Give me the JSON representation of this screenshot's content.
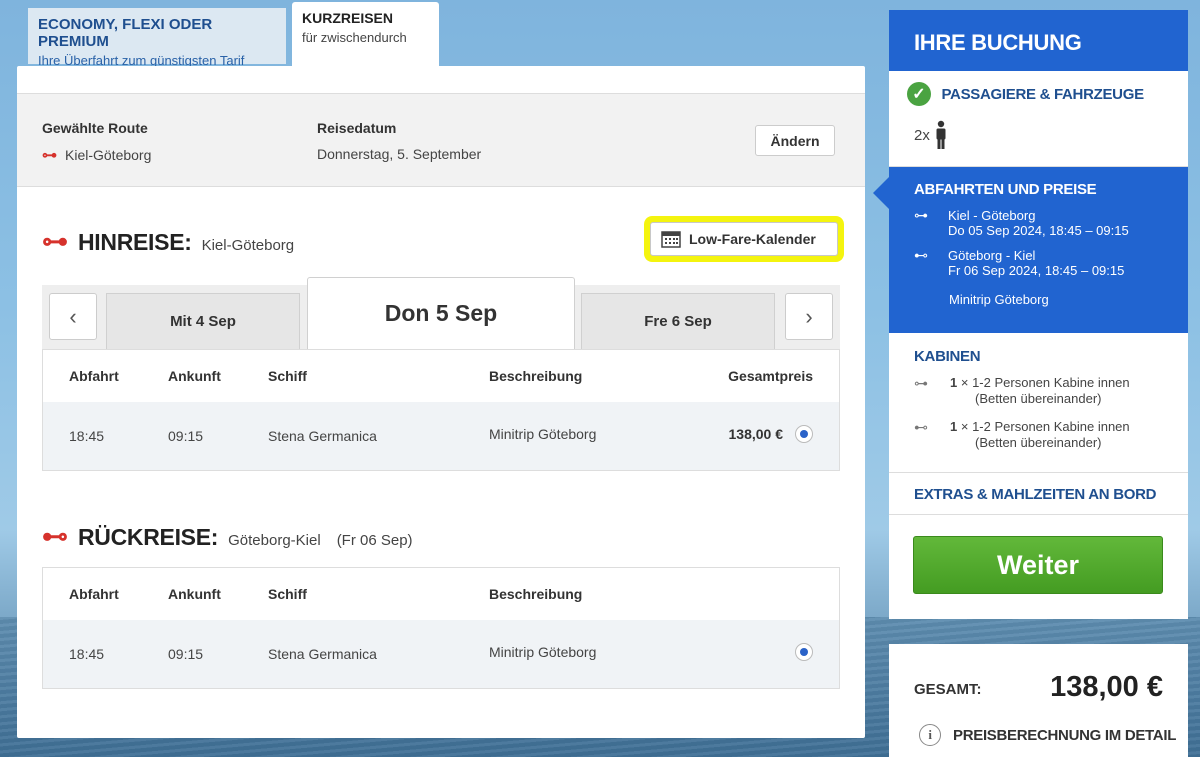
{
  "tabs": {
    "economy": {
      "title": "ECONOMY, FLEXI ODER PREMIUM",
      "subtitle": "Ihre Überfahrt zum günstigsten Tarif"
    },
    "kurzreisen": {
      "title": "KURZREISEN",
      "subtitle": "für zwischendurch"
    }
  },
  "route_box": {
    "route_label": "Gewählte Route",
    "route_value": "Kiel-Göteborg",
    "date_label": "Reisedatum",
    "date_value": "Donnerstag, 5. September",
    "change_button": "Ändern"
  },
  "hinreise": {
    "title": "HINREISE:",
    "route": "Kiel-Göteborg",
    "low_fare_button": "Low-Fare-Kalender",
    "days": {
      "prev": "Mit 4 Sep",
      "active": "Don 5 Sep",
      "next": "Fre 6 Sep"
    },
    "headers": [
      "Abfahrt",
      "Ankunft",
      "Schiff",
      "Beschreibung",
      "Gesamtpreis"
    ],
    "row": {
      "abfahrt": "18:45",
      "ankunft": "09:15",
      "schiff": "Stena Germanica",
      "beschreibung": "Minitrip Göteborg",
      "preis": "138,00 €"
    }
  },
  "rueckreise": {
    "title": "RÜCKREISE:",
    "route": "Göteborg-Kiel",
    "date": "(Fr 06 Sep)",
    "headers": [
      "Abfahrt",
      "Ankunft",
      "Schiff",
      "Beschreibung"
    ],
    "row": {
      "abfahrt": "18:45",
      "ankunft": "09:15",
      "schiff": "Stena Germanica",
      "beschreibung": "Minitrip Göteborg"
    }
  },
  "sidebar": {
    "title": "IHRE BUCHUNG",
    "passengers": {
      "title": "PASSAGIERE & FAHRZEUGE",
      "count": "2x"
    },
    "abfahrten": {
      "title": "ABFAHRTEN UND PREISE",
      "trips": [
        {
          "route": "Kiel - Göteborg",
          "time": "Do 05 Sep 2024, 18:45 – 09:15"
        },
        {
          "route": "Göteborg - Kiel",
          "time": "Fr 06 Sep 2024, 18:45 – 09:15"
        }
      ],
      "package": "Minitrip Göteborg"
    },
    "kabinen": {
      "title": "KABINEN",
      "items": [
        {
          "qty": "1",
          "x": "×",
          "line1": "1-2 Personen Kabine innen",
          "line2": "(Betten übereinander)"
        },
        {
          "qty": "1",
          "x": "×",
          "line1": "1-2 Personen Kabine innen",
          "line2": "(Betten übereinander)"
        }
      ]
    },
    "extras": "EXTRAS & MAHLZEITEN AN BORD",
    "weiter": "Weiter"
  },
  "total": {
    "label": "GESAMT:",
    "value": "138,00 €",
    "detail": "PREISBERECHNUNG IM DETAIL"
  },
  "colors": {
    "accent_blue": "#2164d0",
    "green": "#4aa341",
    "red": "#d6322c",
    "highlight": "#f4f40f"
  }
}
